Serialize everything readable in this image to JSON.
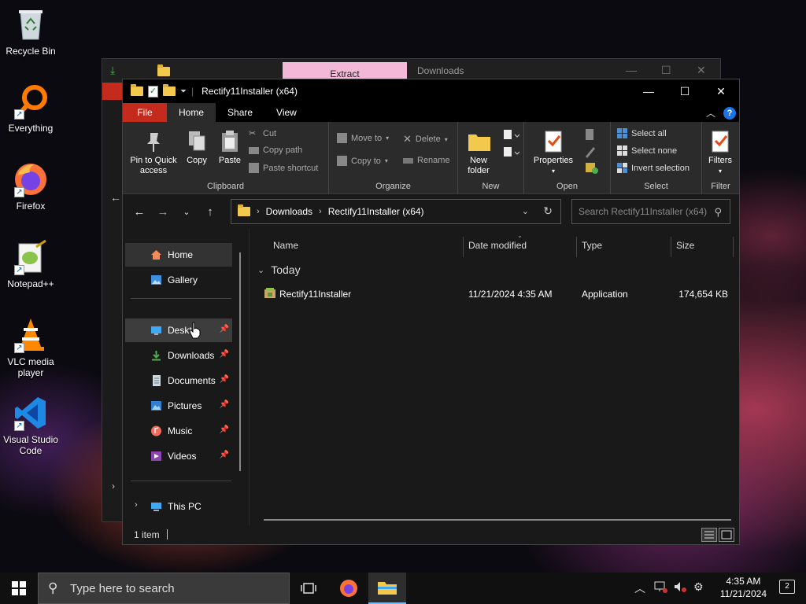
{
  "desktop": {
    "icons": [
      {
        "label": "Recycle Bin",
        "icon": "recycle-bin-icon"
      },
      {
        "label": "Everything",
        "icon": "everything-search-icon"
      },
      {
        "label": "Firefox",
        "icon": "firefox-icon"
      },
      {
        "label": "Notepad++",
        "icon": "notepad-plus-plus-icon"
      },
      {
        "label": "VLC media player",
        "icon": "vlc-icon"
      },
      {
        "label": "Visual Studio Code",
        "icon": "vscode-icon"
      }
    ]
  },
  "back_window": {
    "extract_tab": "Extract",
    "title": "Downloads"
  },
  "window": {
    "title": "Rectify11Installer (x64)",
    "tabs": [
      "File",
      "Home",
      "Share",
      "View"
    ],
    "active_tab": "Home"
  },
  "ribbon": {
    "clipboard": {
      "label": "Clipboard",
      "pin": "Pin to Quick access",
      "copy": "Copy",
      "paste": "Paste",
      "cut": "Cut",
      "copy_path": "Copy path",
      "paste_shortcut": "Paste shortcut"
    },
    "organize": {
      "label": "Organize",
      "move_to": "Move to",
      "copy_to": "Copy to",
      "delete": "Delete",
      "rename": "Rename"
    },
    "new": {
      "label": "New",
      "new_folder": "New folder"
    },
    "open": {
      "label": "Open",
      "properties": "Properties"
    },
    "select": {
      "label": "Select",
      "select_all": "Select all",
      "select_none": "Select none",
      "invert": "Invert selection"
    },
    "filter": {
      "label": "Filter",
      "filters": "Filters"
    }
  },
  "address": {
    "crumbs": [
      "Downloads",
      "Rectify11Installer (x64)"
    ],
    "search_placeholder": "Search Rectify11Installer (x64)"
  },
  "sidebar": {
    "items": [
      {
        "label": "Home",
        "icon": "home-icon",
        "pinned": false
      },
      {
        "label": "Gallery",
        "icon": "gallery-icon",
        "pinned": false
      },
      {
        "label": "Desktop",
        "icon": "desktop-icon",
        "pinned": true
      },
      {
        "label": "Downloads",
        "icon": "downloads-icon",
        "pinned": true
      },
      {
        "label": "Documents",
        "icon": "documents-icon",
        "pinned": true
      },
      {
        "label": "Pictures",
        "icon": "pictures-icon",
        "pinned": true
      },
      {
        "label": "Music",
        "icon": "music-icon",
        "pinned": true
      },
      {
        "label": "Videos",
        "icon": "videos-icon",
        "pinned": true
      },
      {
        "label": "This PC",
        "icon": "this-pc-icon",
        "pinned": false
      }
    ],
    "desktop_label_visible": "Deskt"
  },
  "file_list": {
    "columns": [
      "Name",
      "Date modified",
      "Type",
      "Size"
    ],
    "group": "Today",
    "rows": [
      {
        "name": "Rectify11Installer",
        "date": "11/21/2024 4:35 AM",
        "type": "Application",
        "size": "174,654 KB"
      }
    ]
  },
  "status": {
    "count": "1 item"
  },
  "taskbar": {
    "search_placeholder": "Type here to search",
    "time": "4:35 AM",
    "date": "11/21/2024",
    "notifications": "2"
  },
  "colors": {
    "file_tab": "#c42b1c",
    "ribbon_bg": "#2b2b2b",
    "window_bg": "#191919",
    "extract_tab": "#f3b7d8"
  }
}
